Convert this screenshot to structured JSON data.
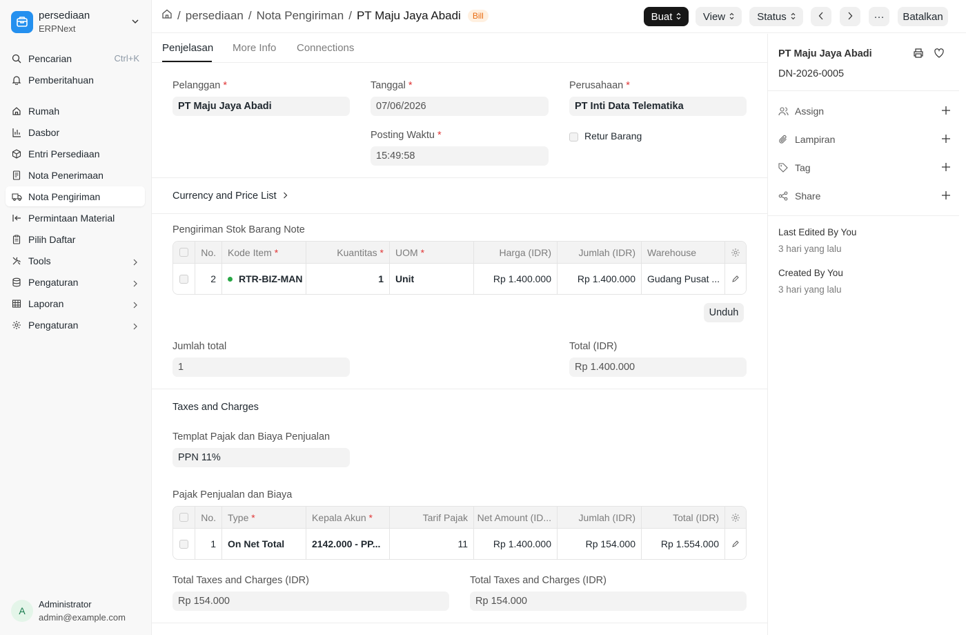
{
  "app": {
    "name": "persediaan",
    "subtitle": "ERPNext"
  },
  "sidebar": {
    "search": {
      "label": "Pencarian",
      "shortcut": "Ctrl+K"
    },
    "notifications": {
      "label": "Pemberitahuan"
    },
    "items": [
      {
        "label": "Rumah",
        "icon": "home-icon"
      },
      {
        "label": "Dasbor",
        "icon": "chart-icon"
      },
      {
        "label": "Entri Persediaan",
        "icon": "box-icon"
      },
      {
        "label": "Nota Penerimaan",
        "icon": "receipt-icon"
      },
      {
        "label": "Nota Pengiriman",
        "icon": "truck-icon",
        "active": true
      },
      {
        "label": "Permintaan Material",
        "icon": "arrow-left-bar-icon"
      },
      {
        "label": "Pilih Daftar",
        "icon": "clipboard-icon"
      },
      {
        "label": "Tools",
        "icon": "tools-icon",
        "expandable": true
      },
      {
        "label": "Pengaturan",
        "icon": "database-icon",
        "expandable": true
      },
      {
        "label": "Laporan",
        "icon": "table-icon",
        "expandable": true
      },
      {
        "label": "Pengaturan",
        "icon": "gear-icon",
        "expandable": true
      }
    ]
  },
  "user": {
    "initial": "A",
    "name": "Administrator",
    "email": "admin@example.com"
  },
  "breadcrumb": {
    "items": [
      "persediaan",
      "Nota Pengiriman"
    ],
    "current": "PT Maju Jaya Abadi",
    "badge": "Bill"
  },
  "toolbar": {
    "create": "Buat",
    "view": "View",
    "status": "Status",
    "more": "···",
    "cancel": "Batalkan"
  },
  "tabs": [
    "Penjelasan",
    "More Info",
    "Connections"
  ],
  "form": {
    "customer": {
      "label": "Pelanggan",
      "value": "PT Maju Jaya Abadi"
    },
    "date": {
      "label": "Tanggal",
      "value": "07/06/2026"
    },
    "company": {
      "label": "Perusahaan",
      "value": "PT Inti Data Telematika"
    },
    "posting_time": {
      "label": "Posting Waktu",
      "value": "15:49:58"
    },
    "is_return": {
      "label": "Retur Barang"
    },
    "currency_section": "Currency and Price List",
    "items_title": "Pengiriman Stok Barang Note",
    "items_table": {
      "headers": [
        "No.",
        "Kode Item",
        "Kuantitas",
        "UOM",
        "Harga (IDR)",
        "Jumlah (IDR)",
        "Warehouse"
      ],
      "rows": [
        {
          "no": "2",
          "item_code": "RTR-BIZ-MAN",
          "qty": "1",
          "uom": "Unit",
          "rate": "Rp 1.400.000",
          "amount": "Rp 1.400.000",
          "warehouse": "Gudang Pusat ..."
        }
      ]
    },
    "download": "Unduh",
    "total_qty": {
      "label": "Jumlah total",
      "value": "1"
    },
    "total": {
      "label": "Total (IDR)",
      "value": "Rp 1.400.000"
    },
    "taxes_section": "Taxes and Charges",
    "tax_template": {
      "label": "Templat Pajak dan Biaya Penjualan",
      "value": "PPN 11%"
    },
    "taxes_title": "Pajak Penjualan dan Biaya",
    "taxes_table": {
      "headers": [
        "No.",
        "Type",
        "Kepala Akun",
        "Tarif Pajak",
        "Net Amount (ID...",
        "Jumlah (IDR)",
        "Total (IDR)"
      ],
      "rows": [
        {
          "no": "1",
          "type": "On Net Total",
          "account": "2142.000 - PP...",
          "rate": "11",
          "net": "Rp 1.400.000",
          "amount": "Rp 154.000",
          "total": "Rp 1.554.000"
        }
      ]
    },
    "total_taxes_1": {
      "label": "Total Taxes and Charges (IDR)",
      "value": "Rp 154.000"
    },
    "total_taxes_2": {
      "label": "Total Taxes and Charges (IDR)",
      "value": "Rp 154.000"
    }
  },
  "right_panel": {
    "title": "PT Maju Jaya Abadi",
    "doc_id": "DN-2026-0005",
    "actions": [
      "Assign",
      "Lampiran",
      "Tag",
      "Share"
    ],
    "last_edited": "Last Edited By You",
    "last_edited_time": "3 hari yang lalu",
    "created": "Created By You",
    "created_time": "3 hari yang lalu"
  },
  "colors": {
    "accent": "#2490ef",
    "dark_button": "#171717",
    "badge_bg": "#fff0e0",
    "badge_text": "#e86c13",
    "required": "#e03636",
    "status_dot": "#28a745"
  }
}
